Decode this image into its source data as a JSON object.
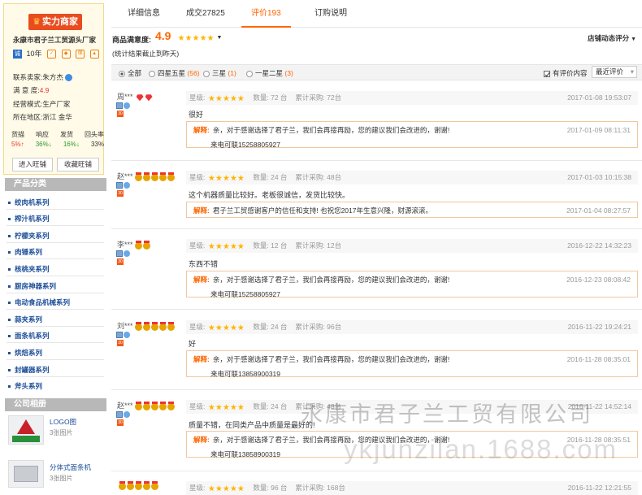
{
  "store": {
    "badge": "实力商家",
    "name": "永康市君子兰工贸源头厂家",
    "years_badge": "诚",
    "years": "10年",
    "contact_label": "联系卖家:",
    "contact_value": "朱方杰",
    "satisfaction_label": "满 意 度:",
    "satisfaction_value": "4.9",
    "mode_label": "经营模式:",
    "mode_value": "生产厂家",
    "location_label": "所在地区:",
    "location_value": "浙江 金华",
    "stats_headers": [
      "货描",
      "响应",
      "发货",
      "回头率"
    ],
    "stats_values": [
      "5%↑",
      "36%↓",
      "16%↓",
      "33%"
    ],
    "btn_enter": "进入旺铺",
    "btn_fav": "收藏旺铺"
  },
  "categories_title": "产品分类",
  "categories": [
    "绞肉机系列",
    "榨汁机系列",
    "柠檬夹系列",
    "肉锤系列",
    "核桃夹系列",
    "厨房神器系列",
    "电动食品机械系列",
    "蒜夹系列",
    "面条机系列",
    "烘焙系列",
    "封罐器系列",
    "斧头系列"
  ],
  "albums_title": "公司相册",
  "albums": [
    {
      "name": "LOGO图",
      "count": "3张图片"
    },
    {
      "name": "分体式面条机",
      "count": "3张图片"
    }
  ],
  "tabs": [
    "详细信息",
    "成交27825",
    "评价193",
    "订购说明"
  ],
  "summary": {
    "label": "商品满意度:",
    "score": "4.9",
    "dynamic": "店铺动态评分",
    "note": "(统计结果截止到昨天)"
  },
  "filter": {
    "all": "全部",
    "four_five": "四星五星",
    "four_five_count": "(56)",
    "three": "三星",
    "three_count": "(1)",
    "one_two": "一星二星",
    "one_two_count": "(3)",
    "has_content": "有评价内容",
    "sort": "最近评价"
  },
  "reviews": [
    {
      "user": "周***",
      "medals": 0,
      "diamond": true,
      "rating_label": "星级:",
      "qty": "数量: 72 台",
      "total": "累计采购: 72台",
      "date": "2017-01-08 19:53:07",
      "text": "很好",
      "reply_label": "解释:",
      "reply": "亲，对于感谢选择了君子兰，我们会再接再励，您的建议我们会改进的，谢谢!",
      "reply_line2": "来电可联15258805927",
      "reply_date": "2017-01-09 08:11:31"
    },
    {
      "user": "赵***",
      "medals": 5,
      "diamond": false,
      "rating_label": "星级:",
      "qty": "数量: 24 台",
      "total": "累计采购: 48台",
      "date": "2017-01-03 10:15:38",
      "text": "这个机器质量比较好。老板很诚信，发货比较快。",
      "reply_label": "解释:",
      "reply": "君子兰工贸感谢客户的信任和支持! 也祝您2017年生意兴隆，财源滚滚。",
      "reply_line2": "",
      "reply_date": "2017-01-04 08:27:57"
    },
    {
      "user": "李***",
      "medals": 2,
      "diamond": false,
      "rating_label": "星级:",
      "qty": "数量: 12 台",
      "total": "累计采购: 12台",
      "date": "2016-12-22 14:32:23",
      "text": "东西不错",
      "reply_label": "解释:",
      "reply": "亲，对于感谢选择了君子兰，我们会再接再励，您的建议我们会改进的，谢谢!",
      "reply_line2": "来电可联15258805927",
      "reply_date": "2016-12-23 08:08:42"
    },
    {
      "user": "刘***",
      "medals": 5,
      "diamond": false,
      "rating_label": "星级:",
      "qty": "数量: 24 台",
      "total": "累计采购: 96台",
      "date": "2016-11-22 19:24:21",
      "text": "好",
      "reply_label": "解释:",
      "reply": "亲，对于感谢选择了君子兰，我们会再接再励，您的建议我们会改进的，谢谢!",
      "reply_line2": "来电可联13858900319",
      "reply_date": "2016-11-28 08:35:01"
    },
    {
      "user": "赵***",
      "medals": 5,
      "diamond": false,
      "rating_label": "星级:",
      "qty": "数量: 24 台",
      "total": "累计采购: 48台",
      "date": "2016-11-22 14:52:14",
      "text": "质量不错，在同类产品中质量是最好的!",
      "reply_label": "解释:",
      "reply": "亲，对于感谢选择了君子兰，我们会再接再励，您的建议我们会改进的，谢谢!",
      "reply_line2": "来电可联13858900319",
      "reply_date": "2016-11-28 08:35:51"
    },
    {
      "user": "",
      "medals": 5,
      "diamond": false,
      "rating_label": "星级:",
      "qty": "数量: 96 台",
      "total": "累计采购: 168台",
      "date": "2016-11-22 12:21:55",
      "text": "",
      "reply_label": "",
      "reply": "",
      "reply_line2": "",
      "reply_date": ""
    }
  ],
  "watermark": {
    "line1": "永康市君子兰工贸有限公司",
    "line2": "ykjunzilan.1688.com"
  },
  "colors": {
    "accent": "#ff6600",
    "link": "#1d4f98",
    "badge": "#e84c1f"
  }
}
